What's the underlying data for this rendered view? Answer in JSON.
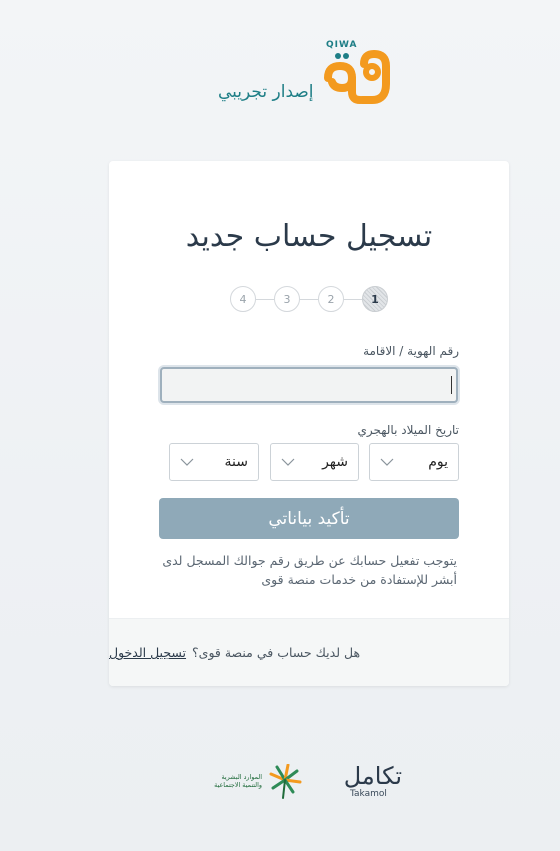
{
  "brand": {
    "latin_name": "QIWA",
    "beta_label": "إصدار تجريبي",
    "accent_orange": "#f39a1f",
    "accent_teal": "#1e7e86"
  },
  "form": {
    "title": "تسجيل حساب جديد",
    "steps": [
      "1",
      "2",
      "3",
      "4"
    ],
    "active_step": 1,
    "id_label": "رقم الهوية / الاقامة",
    "id_value": "",
    "dob_label": "تاريخ الميلاد بالهجري",
    "day_select": "يوم",
    "month_select": "شهر",
    "year_select": "سنة",
    "confirm_button": "تأكيد بياناتي",
    "note": "يتوجب تفعيل حسابك عن طريق رقم جوالك المسجل لدى أبشر للإستفادة من خدمات منصة قوى",
    "button_color": "#8fa9b8"
  },
  "footer": {
    "question": "هل لديك حساب في منصة قوى؟",
    "login_link": "تسجيل الدخول"
  },
  "partners": {
    "hrsd_line1": "الموارد البشرية",
    "hrsd_line2": "والتنمية الاجتماعية",
    "takamol_ar": "تكامل",
    "takamol_en": "Takamol"
  }
}
